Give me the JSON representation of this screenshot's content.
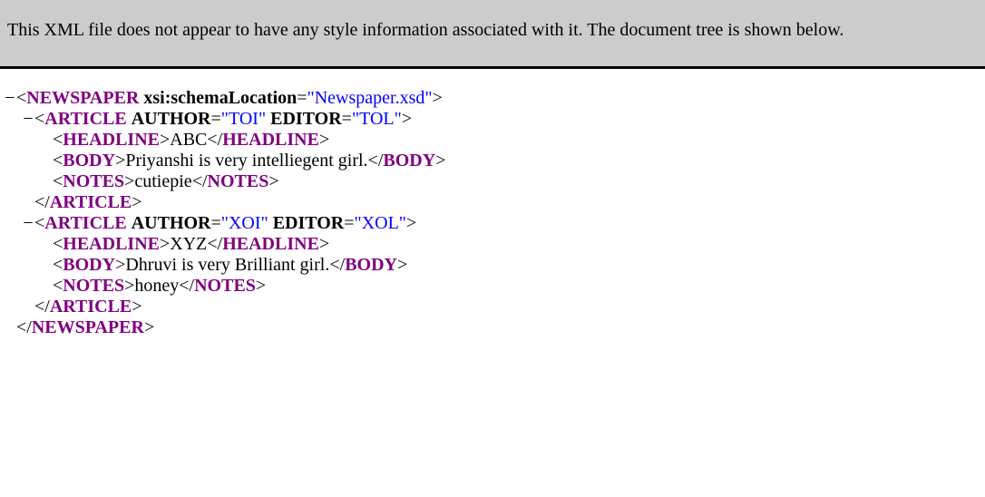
{
  "info": {
    "message": "This XML file does not appear to have any style information associated with it. The document tree is shown below."
  },
  "symbols": {
    "collapse": "−",
    "lt": "<",
    "gt": ">",
    "close_lt": "</",
    "eq": "=",
    "quote": "\""
  },
  "colors": {
    "info_bar_bg": "#cccccc",
    "tag_name": "#800080",
    "attr_value": "#0000ff",
    "text": "#000000"
  },
  "tree": {
    "root": {
      "tag": "NEWSPAPER",
      "attr_name": "xsi:schemaLocation",
      "attr_value": "Newspaper.xsd",
      "close_tag": "NEWSPAPER"
    },
    "articles": [
      {
        "tag": "ARTICLE",
        "author_attr": "AUTHOR",
        "author_value": "TOI",
        "editor_attr": "EDITOR",
        "editor_value": "TOL",
        "headline_tag": "HEADLINE",
        "headline_text": "ABC",
        "body_tag": "BODY",
        "body_text": "Priyanshi is very intelliegent girl.",
        "notes_tag": "NOTES",
        "notes_text": "cutiepie",
        "close_tag": "ARTICLE"
      },
      {
        "tag": "ARTICLE",
        "author_attr": "AUTHOR",
        "author_value": "XOI",
        "editor_attr": "EDITOR",
        "editor_value": "XOL",
        "headline_tag": "HEADLINE",
        "headline_text": "XYZ",
        "body_tag": "BODY",
        "body_text": "Dhruvi is very Brilliant girl.",
        "notes_tag": "NOTES",
        "notes_text": "honey",
        "close_tag": "ARTICLE"
      }
    ]
  }
}
